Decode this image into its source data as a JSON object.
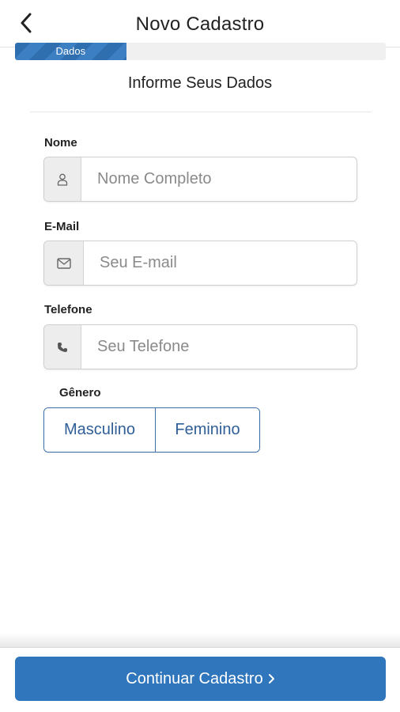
{
  "header": {
    "title": "Novo Cadastro",
    "back_icon": "chevron-left-icon"
  },
  "progress": {
    "label": "Dados",
    "value_fraction": 0.3,
    "color": "#2f6fb0"
  },
  "form": {
    "section_title": "Informe Seus Dados",
    "name": {
      "label": "Nome",
      "placeholder": "Nome Completo",
      "icon": "user-icon"
    },
    "email": {
      "label": "E-Mail",
      "placeholder": "Seu E-mail",
      "icon": "envelope-icon"
    },
    "phone": {
      "label": "Telefone",
      "placeholder": "Seu Telefone",
      "icon": "phone-icon"
    },
    "gender": {
      "label": "Gênero",
      "options": [
        "Masculino",
        "Feminino"
      ]
    }
  },
  "footer": {
    "continue_label": "Continuar Cadastro",
    "continue_icon": "chevron-right-icon",
    "button_color": "#2f76bd"
  }
}
